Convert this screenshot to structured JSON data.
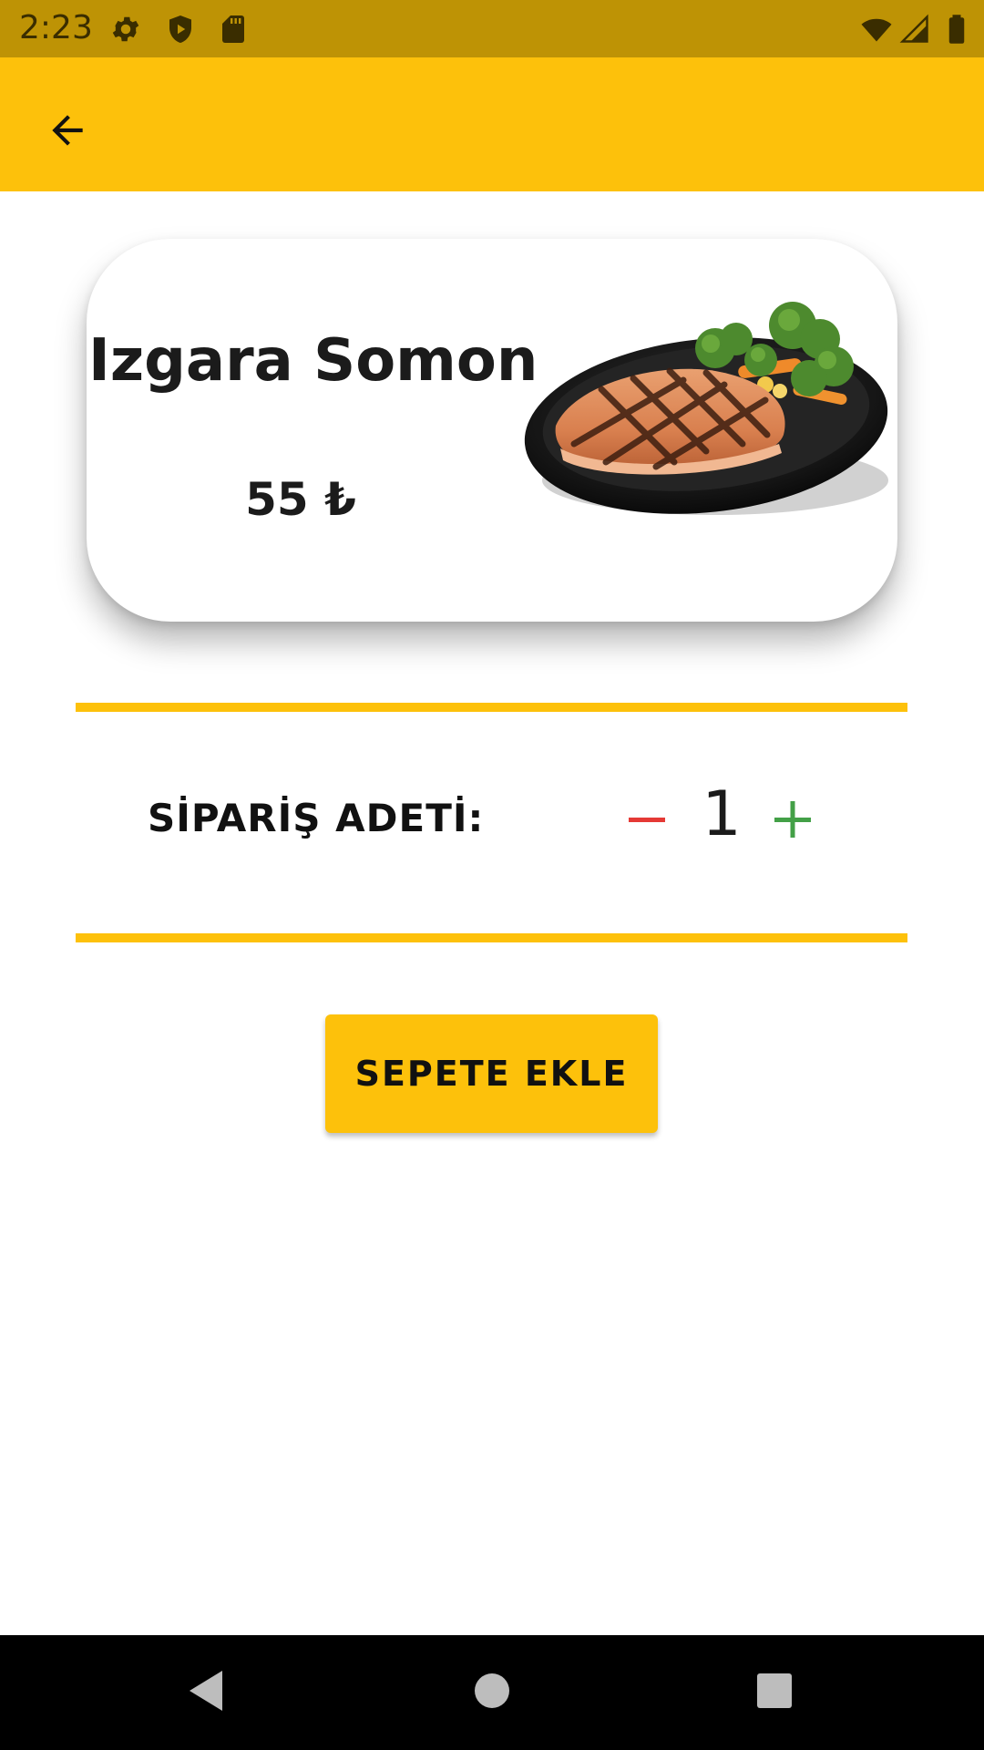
{
  "status_bar": {
    "time": "2:23",
    "icons_left": [
      "gear-icon",
      "shield-play-icon",
      "sd-card-icon"
    ],
    "icons_right": [
      "wifi-icon",
      "signal-icon",
      "battery-icon"
    ]
  },
  "app_bar": {
    "color": "#FDC10B",
    "back_icon": "arrow-left-icon"
  },
  "product": {
    "name": "Izgara Somon",
    "price": "55 ₺",
    "image": "grilled-salmon-plate"
  },
  "quantity": {
    "label": "SİPARİŞ ADETİ:",
    "value": "1",
    "decrease_icon": "minus-icon",
    "increase_icon": "plus-icon",
    "decrease_color": "#E53935",
    "increase_color": "#43A047"
  },
  "add_to_cart": {
    "label": "SEPETE EKLE"
  },
  "nav_bar": {
    "icons": [
      "back-triangle-icon",
      "home-circle-icon",
      "recents-square-icon"
    ]
  }
}
